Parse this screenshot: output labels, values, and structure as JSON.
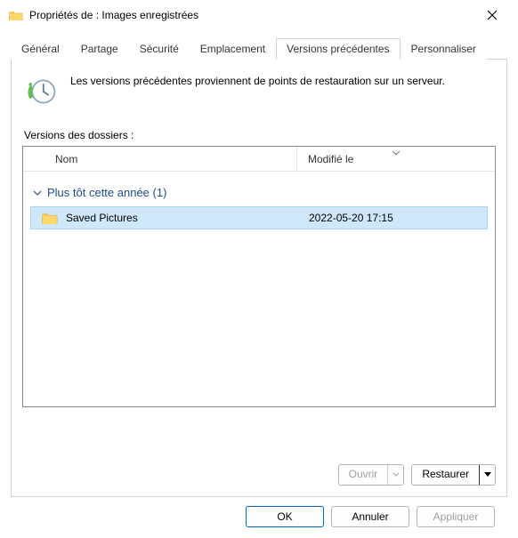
{
  "window": {
    "title": "Propriétés de : Images enregistrées"
  },
  "tabs": {
    "general": "Général",
    "partage": "Partage",
    "securite": "Sécurité",
    "emplacement": "Emplacement",
    "versions": "Versions précédentes",
    "personnaliser": "Personnaliser"
  },
  "body": {
    "description": "Les versions précédentes proviennent de points de restauration sur un serveur.",
    "versions_label": "Versions des dossiers :",
    "columns": {
      "name": "Nom",
      "modified": "Modifié le"
    },
    "group": {
      "label": "Plus tôt cette année (1)"
    },
    "item": {
      "name": "Saved Pictures",
      "modified": "2022-05-20 17:15"
    },
    "actions": {
      "open": "Ouvrir",
      "restore": "Restaurer"
    }
  },
  "dialog": {
    "ok": "OK",
    "cancel": "Annuler",
    "apply": "Appliquer"
  }
}
